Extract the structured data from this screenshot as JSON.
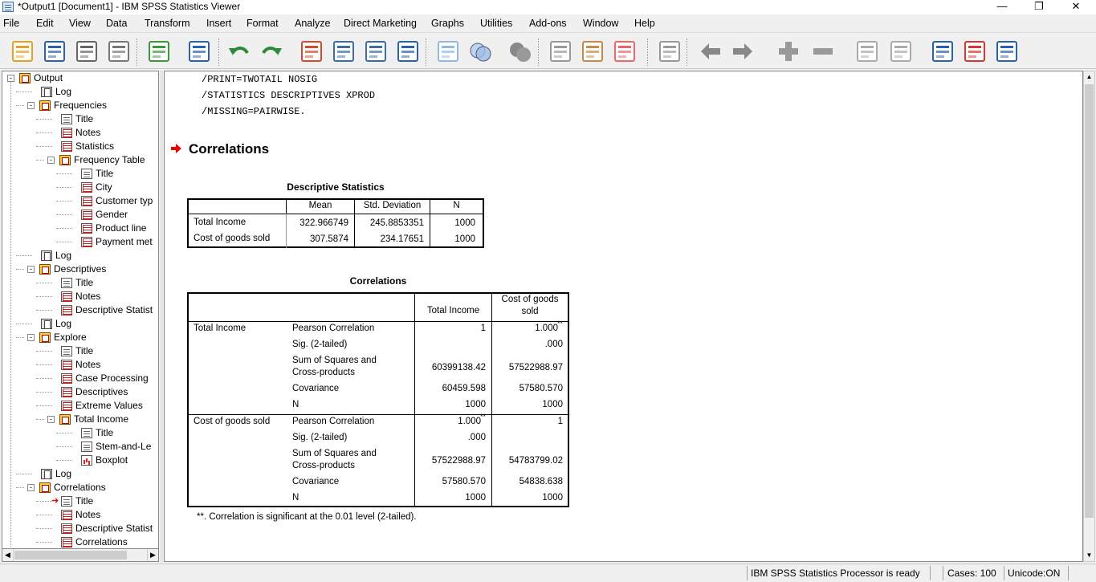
{
  "window": {
    "title": "*Output1 [Document1] - IBM SPSS Statistics Viewer",
    "minimize": "—",
    "restore": "❐",
    "close": "✕"
  },
  "menu": [
    "File",
    "Edit",
    "View",
    "Data",
    "Transform",
    "Insert",
    "Format",
    "Analyze",
    "Direct Marketing",
    "Graphs",
    "Utilities",
    "Add-ons",
    "Window",
    "Help"
  ],
  "toolbar": [
    "open-icon",
    "save-icon",
    "print-icon",
    "print-preview-icon",
    "export-icon",
    "recall-dialog-icon",
    "undo-icon",
    "redo-icon",
    "goto-data-icon",
    "goto-variable-icon",
    "insert-cases-icon",
    "insert-variable-icon",
    "value-labels-icon",
    "use-sets-icon",
    "select-outline-icon",
    "designate-window-icon",
    "create-report-icon",
    "run-script-icon",
    "toggle-icon",
    "back-icon",
    "forward-icon",
    "expand-icon",
    "collapse-icon",
    "show-icon",
    "hide-icon",
    "insert-heading-icon",
    "insert-title-icon",
    "insert-text-icon"
  ],
  "tree": [
    {
      "label": "Output",
      "icon": "book",
      "level": 0,
      "pm": "-"
    },
    {
      "label": "Log",
      "icon": "log",
      "level": 1
    },
    {
      "label": "Frequencies",
      "icon": "book",
      "level": 1,
      "pm": "-"
    },
    {
      "label": "Title",
      "icon": "page",
      "level": 2
    },
    {
      "label": "Notes",
      "icon": "table",
      "level": 2
    },
    {
      "label": "Statistics",
      "icon": "table",
      "level": 2
    },
    {
      "label": "Frequency Table",
      "icon": "book",
      "level": 2,
      "pm": "-"
    },
    {
      "label": "Title",
      "icon": "page",
      "level": 3
    },
    {
      "label": "City",
      "icon": "table",
      "level": 3
    },
    {
      "label": "Customer typ",
      "icon": "table",
      "level": 3
    },
    {
      "label": "Gender",
      "icon": "table",
      "level": 3
    },
    {
      "label": "Product line",
      "icon": "table",
      "level": 3
    },
    {
      "label": "Payment met",
      "icon": "table",
      "level": 3
    },
    {
      "label": "Log",
      "icon": "log",
      "level": 1
    },
    {
      "label": "Descriptives",
      "icon": "book",
      "level": 1,
      "pm": "-"
    },
    {
      "label": "Title",
      "icon": "page",
      "level": 2
    },
    {
      "label": "Notes",
      "icon": "table",
      "level": 2
    },
    {
      "label": "Descriptive Statist",
      "icon": "table",
      "level": 2
    },
    {
      "label": "Log",
      "icon": "log",
      "level": 1
    },
    {
      "label": "Explore",
      "icon": "book",
      "level": 1,
      "pm": "-"
    },
    {
      "label": "Title",
      "icon": "page",
      "level": 2
    },
    {
      "label": "Notes",
      "icon": "table",
      "level": 2
    },
    {
      "label": "Case Processing",
      "icon": "table",
      "level": 2
    },
    {
      "label": "Descriptives",
      "icon": "table",
      "level": 2
    },
    {
      "label": "Extreme Values",
      "icon": "table",
      "level": 2
    },
    {
      "label": "Total Income",
      "icon": "book",
      "level": 2,
      "pm": "-"
    },
    {
      "label": "Title",
      "icon": "page",
      "level": 3
    },
    {
      "label": "Stem-and-Le",
      "icon": "page",
      "level": 3
    },
    {
      "label": "Boxplot",
      "icon": "chart",
      "level": 3
    },
    {
      "label": "Log",
      "icon": "log",
      "level": 1
    },
    {
      "label": "Correlations",
      "icon": "book",
      "level": 1,
      "pm": "-"
    },
    {
      "label": "Title",
      "icon": "page",
      "level": 2,
      "selected": true
    },
    {
      "label": "Notes",
      "icon": "table",
      "level": 2
    },
    {
      "label": "Descriptive Statist",
      "icon": "table",
      "level": 2
    },
    {
      "label": "Correlations",
      "icon": "table",
      "level": 2
    }
  ],
  "syntax": [
    "/PRINT=TWOTAIL NOSIG",
    "/STATISTICS DESCRIPTIVES XPROD",
    "/MISSING=PAIRWISE."
  ],
  "section_title": "Correlations",
  "desc": {
    "title": "Descriptive Statistics",
    "headers": [
      "Mean",
      "Std. Deviation",
      "N"
    ],
    "rows": [
      [
        "Total Income",
        "322.966749",
        "245.8853351",
        "1000"
      ],
      [
        "Cost of goods sold",
        "307.5874",
        "234.17651",
        "1000"
      ]
    ]
  },
  "corr": {
    "title": "Correlations",
    "headers": [
      "Total Income",
      "Cost of goods sold"
    ],
    "groups": [
      {
        "var": "Total Income",
        "rows": [
          [
            "Pearson Correlation",
            "1",
            "1.000"
          ],
          [
            "Sig. (2-tailed)",
            "",
            ".000"
          ],
          [
            "Sum of Squares and Cross-products",
            "60399138.42",
            "57522988.97"
          ],
          [
            "Covariance",
            "60459.598",
            "57580.570"
          ],
          [
            "N",
            "1000",
            "1000"
          ]
        ]
      },
      {
        "var": "Cost of goods sold",
        "rows": [
          [
            "Pearson Correlation",
            "1.000",
            "1"
          ],
          [
            "Sig. (2-tailed)",
            ".000",
            ""
          ],
          [
            "Sum of Squares and Cross-products",
            "57522988.97",
            "54783799.02"
          ],
          [
            "Covariance",
            "57580.570",
            "54838.638"
          ],
          [
            "N",
            "1000",
            "1000"
          ]
        ]
      }
    ],
    "sup": "**",
    "footnote": "**. Correlation is significant at the 0.01 level (2-tailed)."
  },
  "status": {
    "processor": "IBM SPSS Statistics Processor is ready",
    "cases": "Cases: 100",
    "unicode": "Unicode:ON"
  }
}
